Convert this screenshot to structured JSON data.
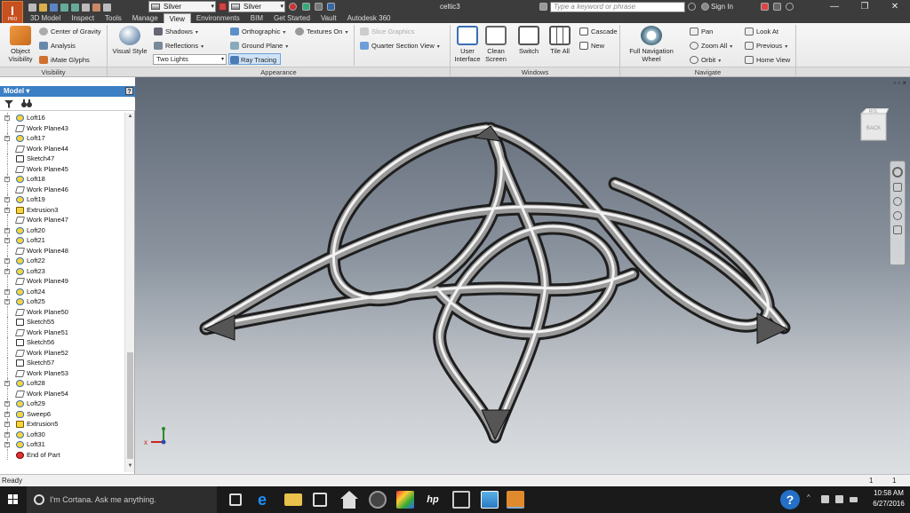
{
  "title_bar": {
    "app_button_label": "I",
    "app_button_sub": "PRO",
    "material_combo": "Silver",
    "appearance_combo": "Silver",
    "document_title": "celtic3",
    "search_placeholder": "Type a keyword or phrase",
    "sign_in": "Sign In",
    "window_controls": [
      "—",
      "❐",
      "✕"
    ]
  },
  "ribbon_tabs": [
    {
      "label": "3D Model",
      "active": false
    },
    {
      "label": "Inspect",
      "active": false
    },
    {
      "label": "Tools",
      "active": false
    },
    {
      "label": "Manage",
      "active": false
    },
    {
      "label": "View",
      "active": true
    },
    {
      "label": "Environments",
      "active": false
    },
    {
      "label": "BIM",
      "active": false
    },
    {
      "label": "Get Started",
      "active": false
    },
    {
      "label": "Vault",
      "active": false
    },
    {
      "label": "Autodesk 360",
      "active": false
    }
  ],
  "ribbon": {
    "visibility": {
      "title": "Visibility",
      "object_visibility": "Object\nVisibility",
      "center_of_gravity": "Center of Gravity",
      "analysis": "Analysis",
      "imate_glyphs": "iMate Glyphs"
    },
    "appearance": {
      "title": "Appearance",
      "visual_style": "Visual Style",
      "shadows": "Shadows",
      "reflections": "Reflections",
      "lighting_style": "Two Lights",
      "orthographic": "Orthographic",
      "ground_plane": "Ground Plane",
      "ray_tracing": "Ray Tracing",
      "textures_on": "Textures On",
      "slice_graphics": "Slice Graphics",
      "quarter_section_view": "Quarter Section View"
    },
    "windows": {
      "title": "Windows",
      "user_interface": "User\nInterface",
      "clean_screen": "Clean\nScreen",
      "switch": "Switch",
      "tile_all": "Tile All",
      "cascade": "Cascade",
      "new": "New"
    },
    "navigate": {
      "title": "Navigate",
      "full_navigation_wheel": "Full Navigation\nWheel",
      "pan": "Pan",
      "zoom_all": "Zoom All",
      "orbit": "Orbit",
      "look_at": "Look At",
      "previous": "Previous",
      "home_view": "Home View"
    }
  },
  "browser": {
    "header": "Model",
    "help": "?",
    "items": [
      {
        "label": "Loft16",
        "type": "loft",
        "expandable": true
      },
      {
        "label": "Work Plane43",
        "type": "plane",
        "expandable": false
      },
      {
        "label": "Loft17",
        "type": "loft",
        "expandable": true
      },
      {
        "label": "Work Plane44",
        "type": "plane",
        "expandable": false
      },
      {
        "label": "Sketch47",
        "type": "sketch",
        "expandable": false
      },
      {
        "label": "Work Plane45",
        "type": "plane",
        "expandable": false
      },
      {
        "label": "Loft18",
        "type": "loft",
        "expandable": true
      },
      {
        "label": "Work Plane46",
        "type": "plane",
        "expandable": false
      },
      {
        "label": "Loft19",
        "type": "loft",
        "expandable": true
      },
      {
        "label": "Extrusion3",
        "type": "extrude",
        "expandable": true
      },
      {
        "label": "Work Plane47",
        "type": "plane",
        "expandable": false
      },
      {
        "label": "Loft20",
        "type": "loft",
        "expandable": true
      },
      {
        "label": "Loft21",
        "type": "loft",
        "expandable": true
      },
      {
        "label": "Work Plane48",
        "type": "plane",
        "expandable": false
      },
      {
        "label": "Loft22",
        "type": "loft",
        "expandable": true
      },
      {
        "label": "Loft23",
        "type": "loft",
        "expandable": true
      },
      {
        "label": "Work Plane49",
        "type": "plane",
        "expandable": false
      },
      {
        "label": "Loft24",
        "type": "loft",
        "expandable": true
      },
      {
        "label": "Loft25",
        "type": "loft",
        "expandable": true
      },
      {
        "label": "Work Plane50",
        "type": "plane",
        "expandable": false
      },
      {
        "label": "Sketch55",
        "type": "sketch",
        "expandable": false
      },
      {
        "label": "Work Plane51",
        "type": "plane",
        "expandable": false
      },
      {
        "label": "Sketch56",
        "type": "sketch",
        "expandable": false
      },
      {
        "label": "Work Plane52",
        "type": "plane",
        "expandable": false
      },
      {
        "label": "Sketch57",
        "type": "sketch",
        "expandable": false
      },
      {
        "label": "Work Plane53",
        "type": "plane",
        "expandable": false
      },
      {
        "label": "Loft28",
        "type": "loft",
        "expandable": true
      },
      {
        "label": "Work Plane54",
        "type": "plane",
        "expandable": false
      },
      {
        "label": "Loft29",
        "type": "loft",
        "expandable": true
      },
      {
        "label": "Sweep6",
        "type": "sweep",
        "expandable": true
      },
      {
        "label": "Extrusion5",
        "type": "extrude",
        "expandable": true
      },
      {
        "label": "Loft30",
        "type": "loft",
        "expandable": true
      },
      {
        "label": "Loft31",
        "type": "loft",
        "expandable": true
      },
      {
        "label": "End of Part",
        "type": "end",
        "expandable": false
      }
    ]
  },
  "viewport": {
    "viewcube_top": "ROL",
    "viewcube_face": "BACK",
    "triad_x": "x",
    "window_ctrls": "▫ ▫ ×"
  },
  "status_bar": {
    "text": "Ready",
    "count1": "1",
    "count2": "1"
  },
  "taskbar": {
    "cortana_placeholder": "I'm Cortana. Ask me anything.",
    "time": "10:58 AM",
    "date": "6/27/2016",
    "help": "?"
  },
  "colors": {
    "accent": "#3b7fc4",
    "title_bar": "#3c3c3c",
    "app_button": "#c6501f"
  }
}
